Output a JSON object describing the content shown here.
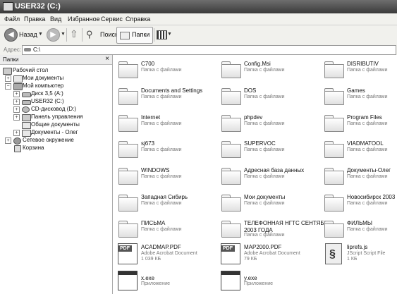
{
  "window": {
    "title": "USER32 (C:)"
  },
  "menu": [
    "Файл",
    "Правка",
    "Вид",
    "Избранное",
    "Сервис",
    "Справка"
  ],
  "toolbar": {
    "back_label": "Назад",
    "search_label": "Поиск",
    "folders_label": "Папки"
  },
  "address": {
    "label": "Адрес:",
    "value": "C:\\"
  },
  "left_pane": {
    "title": "Папки",
    "close": "×",
    "tree": [
      {
        "label": "Рабочий стол",
        "expander": "",
        "icon": "desktop-icon"
      },
      {
        "label": "Мои документы",
        "expander": "+",
        "icon": "folder-icon"
      },
      {
        "label": "Мой компьютер",
        "expander": "−",
        "icon": "computer-icon"
      },
      {
        "label": "Диск 3,5 (A:)",
        "expander": "+",
        "icon": "floppy-icon"
      },
      {
        "label": "USER32 (C:)",
        "expander": "+",
        "icon": "hard-drive-icon"
      },
      {
        "label": "CD-дисковод (D:)",
        "expander": "+",
        "icon": "cd-drive-icon"
      },
      {
        "label": "Панель управления",
        "expander": "+",
        "icon": "control-panel-icon"
      },
      {
        "label": "Общие документы",
        "expander": "",
        "icon": "folder-icon"
      },
      {
        "label": "Документы - Олег",
        "expander": "+",
        "icon": "folder-icon"
      },
      {
        "label": "Сетевое окружение",
        "expander": "+",
        "icon": "network-icon"
      },
      {
        "label": "Корзина",
        "expander": "",
        "icon": "recycle-bin-icon"
      }
    ]
  },
  "content": {
    "folder_sub": "Папка с файлами",
    "items": [
      {
        "name": "C700",
        "type": "folder"
      },
      {
        "name": "Config.Msi",
        "type": "folder"
      },
      {
        "name": "DISRIBUTIV",
        "type": "folder"
      },
      {
        "name": "Documents and Settings",
        "type": "folder"
      },
      {
        "name": "DOS",
        "type": "folder"
      },
      {
        "name": "Games",
        "type": "folder"
      },
      {
        "name": "Internet",
        "type": "folder"
      },
      {
        "name": "phpdev",
        "type": "folder"
      },
      {
        "name": "Program Files",
        "type": "folder"
      },
      {
        "name": "sj673",
        "type": "folder"
      },
      {
        "name": "SUPERVOC",
        "type": "folder"
      },
      {
        "name": "VIADMATOOL",
        "type": "folder"
      },
      {
        "name": "WINDOWS",
        "type": "folder"
      },
      {
        "name": "Адресная база данных",
        "type": "folder"
      },
      {
        "name": "Документы-Олег",
        "type": "folder"
      },
      {
        "name": "Западная Сибирь",
        "type": "folder"
      },
      {
        "name": "Мои документы",
        "type": "folder"
      },
      {
        "name": "Новосибирск 2003",
        "type": "folder"
      },
      {
        "name": "ПИСЬМА",
        "type": "folder"
      },
      {
        "name": "ТЕЛЕФОННАЯ НГТС СЕНТЯБРЬ",
        "name2": "2003 ГОДА",
        "type": "folder"
      },
      {
        "name": "ФИЛЬМЫ",
        "type": "folder"
      },
      {
        "name": "ACADMAP.PDF",
        "type": "pdf",
        "sub": "Adobe Acrobat Document",
        "sub2": "1 039 КБ",
        "tag": "PDF"
      },
      {
        "name": "MAP2000.PDF",
        "type": "pdf",
        "sub": "Adobe Acrobat Document",
        "sub2": "79 КБ",
        "tag": "PDF"
      },
      {
        "name": "liprefs.js",
        "type": "js",
        "sub": "JScript Script File",
        "sub2": "1 КБ"
      },
      {
        "name": "x.exe",
        "type": "exe",
        "sub": "Приложение"
      },
      {
        "name": "y.exe",
        "type": "exe",
        "sub": "Приложение"
      }
    ]
  }
}
